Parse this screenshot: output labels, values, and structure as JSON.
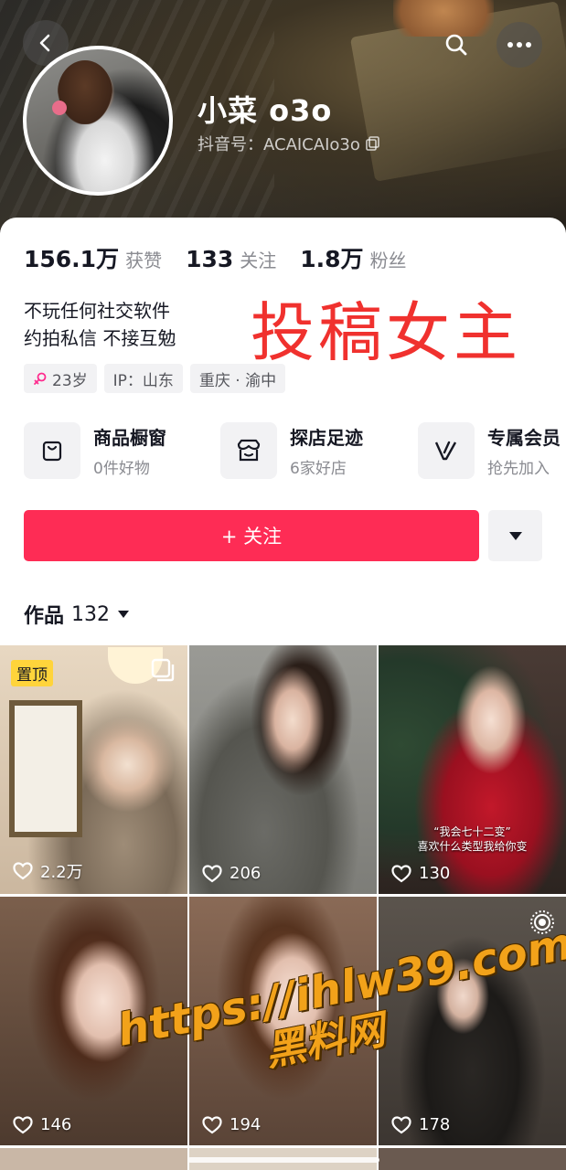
{
  "header": {
    "name": "小菜 o3o",
    "douyin_id": "抖音号：ACAICAIo3o",
    "icons": [
      "back-icon",
      "search-icon",
      "more-icon",
      "copy-icon"
    ]
  },
  "stats": [
    {
      "num": "156.1万",
      "label": "获赞"
    },
    {
      "num": "133",
      "label": "关注"
    },
    {
      "num": "1.8万",
      "label": "粉丝"
    }
  ],
  "bio": {
    "line1": "不玩任何社交软件",
    "line2": "约拍私信 不接互勉",
    "overlay": "投稿女主"
  },
  "tags": [
    {
      "text": "23岁",
      "icon": "female-icon"
    },
    {
      "text": "IP：山东"
    },
    {
      "text": "重庆 · 渝中"
    }
  ],
  "services": [
    {
      "title": "商品橱窗",
      "sub": "0件好物",
      "icon": "shopping-bag-icon"
    },
    {
      "title": "探店足迹",
      "sub": "6家好店",
      "icon": "store-icon"
    },
    {
      "title": "专属会员",
      "sub": "抢先加入",
      "icon": "vip-icon"
    }
  ],
  "actions": {
    "follow": "+ 关注",
    "dropdown_icon": "triangle-down-icon"
  },
  "works": {
    "label": "作品",
    "count": "132",
    "tiles": [
      {
        "likes": "2.2万",
        "pinned": "置顶",
        "multi": true
      },
      {
        "likes": "206"
      },
      {
        "likes": "130",
        "caption1": "“我会七十二变”",
        "caption2": "喜欢什么类型我给你变"
      },
      {
        "likes": "146"
      },
      {
        "likes": "194"
      },
      {
        "likes": "178",
        "live": true
      }
    ]
  },
  "watermark": {
    "url": "https://ihlw39.com",
    "name": "黑料网"
  },
  "colors": {
    "accent": "#fe2c55",
    "overlay_red": "#f0312e",
    "pin_yellow": "#ffd43b",
    "watermark_orange": "#f2a21a"
  }
}
